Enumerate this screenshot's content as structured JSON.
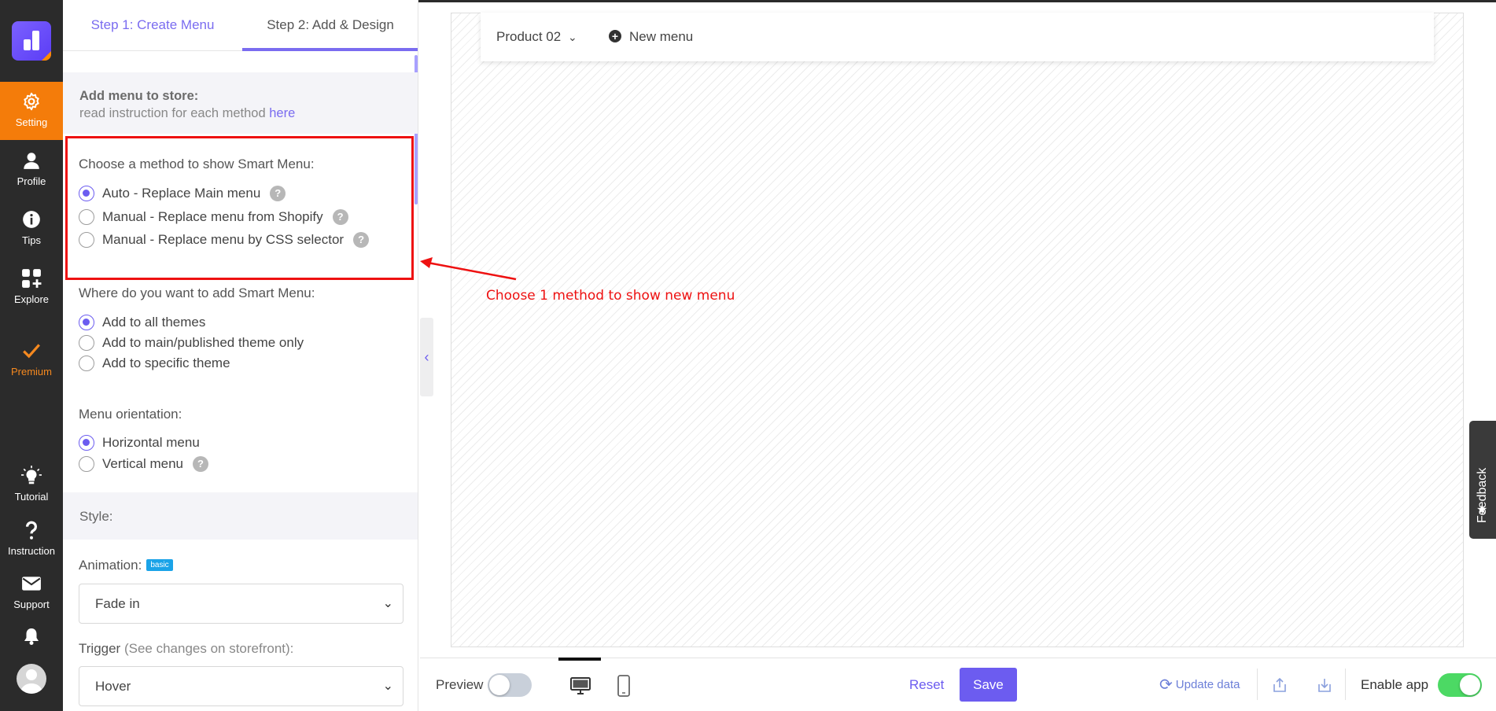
{
  "rail": {
    "items": [
      {
        "label": "Setting",
        "icon": "gear-icon"
      },
      {
        "label": "Profile",
        "icon": "user-icon"
      },
      {
        "label": "Tips",
        "icon": "info-icon"
      },
      {
        "label": "Explore",
        "icon": "apps-plus-icon"
      },
      {
        "label": "Premium",
        "icon": "check-icon"
      },
      {
        "label": "Tutorial",
        "icon": "bulb-icon"
      },
      {
        "label": "Instruction",
        "icon": "question-icon"
      },
      {
        "label": "Support",
        "icon": "mail-icon"
      }
    ],
    "active": "Setting",
    "active_color": "#f47c0a",
    "premium_color": "#f5891f"
  },
  "tabs": {
    "step1": "Step 1: Create Menu",
    "step2": "Step 2: Add & Design"
  },
  "add_store": {
    "heading": "Add menu to store:",
    "sub": "read instruction for each method ",
    "link": "here"
  },
  "method": {
    "label": "Choose a method to show Smart Menu:",
    "options": [
      {
        "label": "Auto - Replace Main menu",
        "selected": true
      },
      {
        "label": "Manual - Replace menu from Shopify",
        "selected": false
      },
      {
        "label": "Manual - Replace menu by CSS selector",
        "selected": false
      }
    ]
  },
  "where": {
    "label": "Where do you want to add Smart Menu:",
    "options": [
      {
        "label": "Add to all themes",
        "selected": true
      },
      {
        "label": "Add to main/published theme only",
        "selected": false
      },
      {
        "label": "Add to specific theme",
        "selected": false
      }
    ]
  },
  "orientation": {
    "label": "Menu orientation:",
    "options": [
      {
        "label": "Horizontal menu",
        "selected": true
      },
      {
        "label": "Vertical menu",
        "selected": false
      }
    ]
  },
  "style": {
    "heading": "Style:",
    "animation_label": "Animation:",
    "animation_badge": "basic",
    "animation_value": "Fade in",
    "trigger_label": "Trigger",
    "trigger_hint": "(See changes on storefront):",
    "trigger_value": "Hover"
  },
  "preview": {
    "menu_item_1": "Product 02",
    "menu_item_2": "New menu",
    "annotation": "Choose 1 method to show new menu"
  },
  "feedback": "Feedback",
  "bottom": {
    "preview_label": "Preview",
    "preview_on": false,
    "reset": "Reset",
    "save": "Save",
    "update_data": "Update data",
    "enable_app": "Enable app",
    "enable_on": true,
    "accent": "#6c5cf0",
    "toggle_on_color": "#4cd964"
  }
}
